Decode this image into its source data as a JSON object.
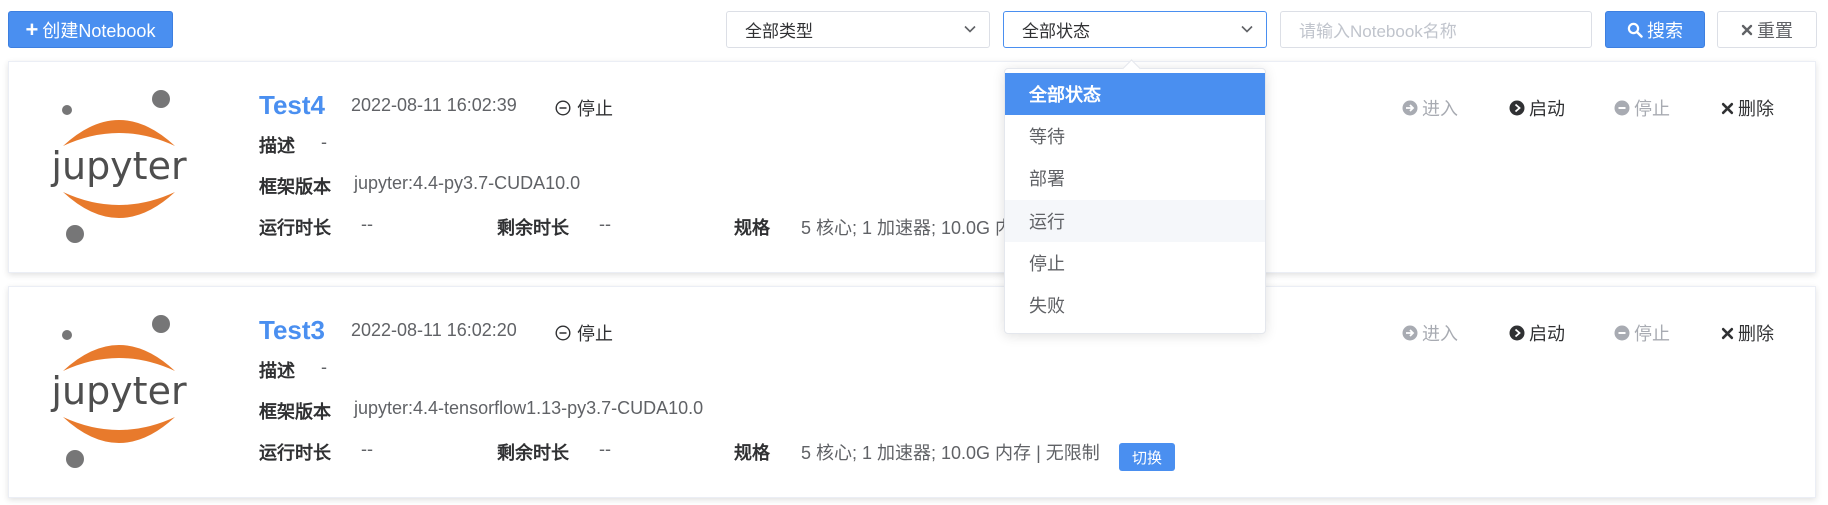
{
  "toolbar": {
    "create_label": "创建Notebook",
    "type_select_value": "全部类型",
    "status_select_value": "全部状态",
    "name_placeholder": "请输入Notebook名称",
    "search_label": "搜索",
    "reset_label": "重置"
  },
  "status_dropdown": {
    "options": [
      "全部状态",
      "等待",
      "部署",
      "运行",
      "停止",
      "失败"
    ],
    "selected": "全部状态",
    "hovered": "运行"
  },
  "labels": {
    "description": "描述",
    "framework": "框架版本",
    "run_duration": "运行时长",
    "remaining": "剩余时长",
    "spec": "规格"
  },
  "actions": {
    "enter": "进入",
    "start": "启动",
    "stop": "停止",
    "delete": "删除"
  },
  "logo_text": "jupyter",
  "notebooks": [
    {
      "name": "Test4",
      "created": "2022-08-11 16:02:39",
      "status": "停止",
      "description": "-",
      "framework": "jupyter:4.4-py3.7-CUDA10.0",
      "run_duration": "--",
      "remaining": "--",
      "spec": "5 核心; 1 加速器; 10.0G 内存 | 无限制"
    },
    {
      "name": "Test3",
      "created": "2022-08-11 16:02:20",
      "status": "停止",
      "description": "-",
      "framework": "jupyter:4.4-tensorflow1.13-py3.7-CUDA10.0",
      "run_duration": "--",
      "remaining": "--",
      "spec": "5 核心; 1 加速器; 10.0G 内存 | 无限制",
      "switch_label": "切换"
    }
  ],
  "colors": {
    "primary": "#4a8ff0",
    "jupyter_orange": "#e87a2c",
    "jupyter_gray": "#767677"
  }
}
